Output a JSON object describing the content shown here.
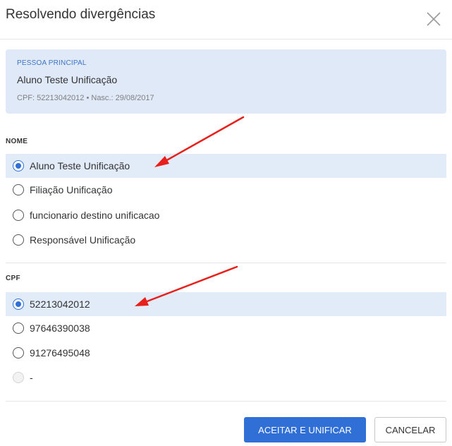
{
  "modal": {
    "title": "Resolvendo divergências"
  },
  "principal": {
    "label": "PESSOA PRINCIPAL",
    "name": "Aluno Teste Unificação",
    "info": "CPF: 52213042012 • Nasc.: 29/08/2017"
  },
  "sections": {
    "nome": {
      "title": "NOME",
      "options": [
        {
          "label": "Aluno Teste Unificação",
          "state": "selected"
        },
        {
          "label": "Filiação Unificação",
          "state": "unselected"
        },
        {
          "label": "funcionario destino unificacao",
          "state": "unselected"
        },
        {
          "label": "Responsável Unificação",
          "state": "unselected"
        }
      ]
    },
    "cpf": {
      "title": "CPF",
      "options": [
        {
          "label": "52213042012",
          "state": "selected"
        },
        {
          "label": "97646390038",
          "state": "unselected"
        },
        {
          "label": "91276495048",
          "state": "unselected"
        },
        {
          "label": "-",
          "state": "disabled"
        }
      ]
    }
  },
  "buttons": {
    "accept": "ACEITAR E UNIFICAR",
    "cancel": "CANCELAR"
  },
  "colors": {
    "accent": "#2f6fd6",
    "selected_row": "#e2ebf8",
    "principal_bg": "#dfe9f8",
    "annotation_arrow": "#e8201c"
  },
  "icons": {
    "close": "close-icon",
    "annotation": "arrow-annotation-icon"
  }
}
